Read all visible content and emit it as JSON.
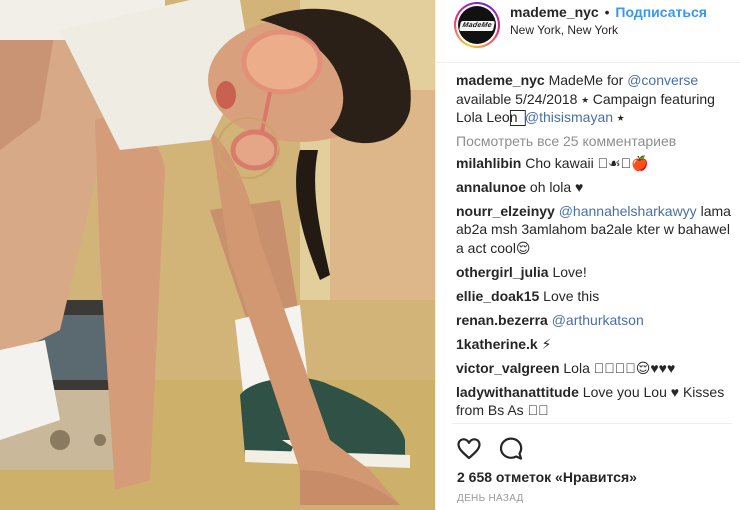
{
  "header": {
    "avatar_logo": "MadeMe",
    "username": "mademe_nyc",
    "separator": "•",
    "follow_label": "Подписаться",
    "location": "New York, New York"
  },
  "caption": {
    "username": "mademe_nyc",
    "text_1": " MadeMe for ",
    "mention_1": "@converse",
    "text_2": " available 5/24/2018 ⭑ Campaign featuring Lola Leon ⃞ ",
    "mention_2": "@thisismayan",
    "text_3": " ⭑"
  },
  "view_all_label": "Посмотреть все 25 комментариев",
  "comments": [
    {
      "username": "milahlibin",
      "text": " Cho kawaii ⃞☙⭑🍎"
    },
    {
      "username": "annalunoe",
      "text": " oh lola ♥"
    },
    {
      "username": "nourr_elzeinyy",
      "mention": "@hannahelsharkawyy",
      "text": " lama ab2a msh 3amlahom ba2ale kter w bahawel a act cool😌"
    },
    {
      "username": "othergirl_julia",
      "text": " Love!"
    },
    {
      "username": "ellie_doak15",
      "text": " Love this"
    },
    {
      "username": "renan.bezerra",
      "mention": "@arthurkatson",
      "text": ""
    },
    {
      "username": "1katherine.k",
      "text": " ⚡"
    },
    {
      "username": "victor_valgreen",
      "text": " Lola ⃞⃞⃞⃞😌♥♥♥"
    },
    {
      "username": "ladywithanattitude",
      "text": " Love you Lou ♥ Kisses from Bs As ⃞⃞"
    }
  ],
  "actions": {
    "like_icon": "heart-icon",
    "comment_icon": "comment-bubble-icon"
  },
  "likes_label": "2 658 отметок «Нравится»",
  "timestamp": "ДЕНЬ НАЗАД",
  "colors": {
    "link_blue": "#3897f0",
    "mention": "#003569",
    "meta_grey": "#8e8e8e"
  }
}
